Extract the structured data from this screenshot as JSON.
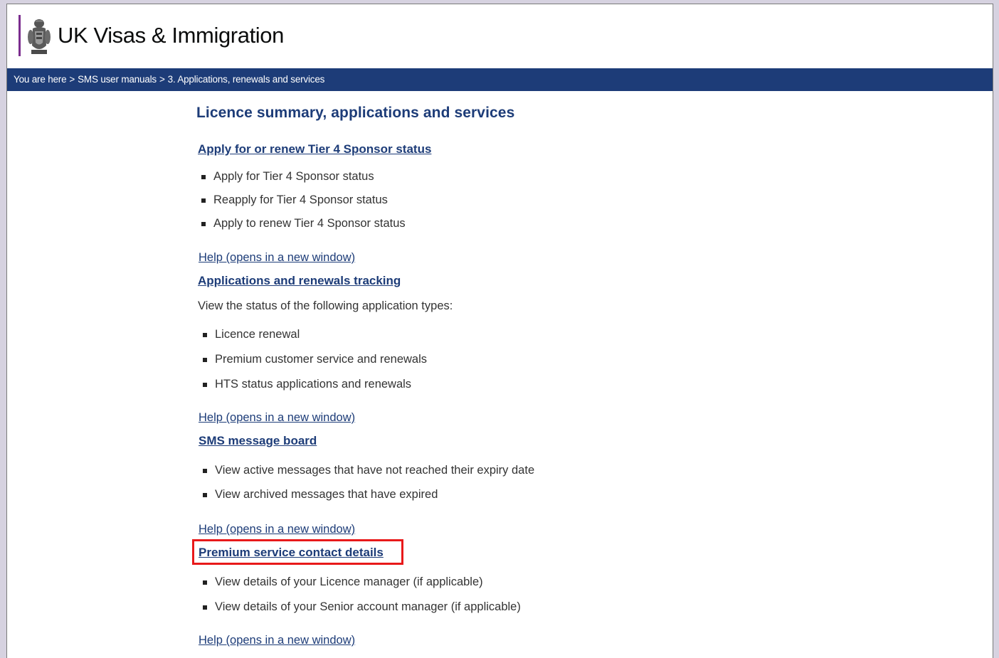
{
  "header": {
    "site_title": "UK Visas & Immigration",
    "crest_icon": "royal-crest-icon",
    "accent_color": "#7b2d8e"
  },
  "breadcrumb": {
    "prefix": "You are here",
    "items": [
      "SMS user manuals",
      "3. Applications, renewals and services"
    ],
    "separator": ">",
    "background_color": "#1d3c78"
  },
  "main": {
    "page_title": "Licence summary, applications and services",
    "sections": [
      {
        "title": "Apply for or renew Tier 4 Sponsor status",
        "intro": "",
        "bullets": [
          "Apply for Tier 4 Sponsor status",
          "Reapply for Tier 4 Sponsor status",
          "Apply to renew Tier 4 Sponsor status"
        ],
        "help": "Help (opens in a new window)"
      },
      {
        "title": "Applications and renewals tracking",
        "intro": "View the status of the following application types:",
        "bullets": [
          "Licence renewal",
          "Premium customer service and renewals",
          "HTS status applications and renewals"
        ],
        "help": "Help (opens in a new window)"
      },
      {
        "title": "SMS message board",
        "intro": "",
        "bullets": [
          "View active messages that have not reached their expiry date",
          "View archived messages that have expired"
        ],
        "help": "Help (opens in a new window)"
      },
      {
        "title": "Premium service contact details",
        "highlighted": true,
        "intro": "",
        "bullets": [
          "View details of your Licence manager (if applicable)",
          "View details of your Senior account manager (if applicable)"
        ],
        "help": "Help (opens in a new window)"
      }
    ],
    "link_color": "#1d3c78",
    "highlight_color": "#e8191a"
  }
}
